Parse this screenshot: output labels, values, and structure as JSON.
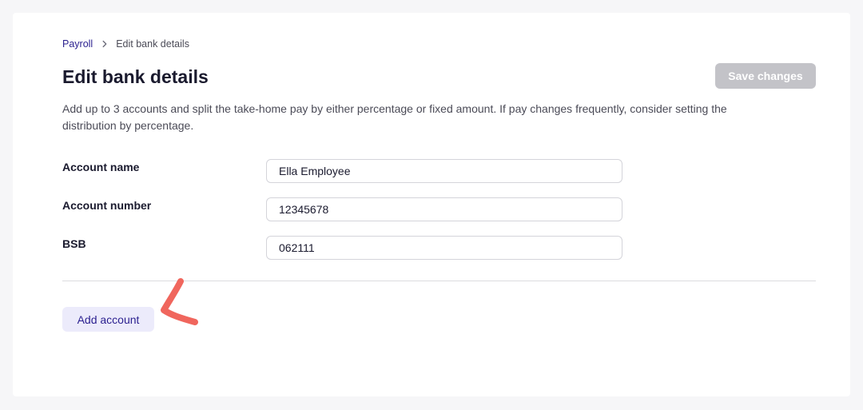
{
  "breadcrumb": {
    "parent": "Payroll",
    "current": "Edit bank details"
  },
  "page": {
    "title": "Edit bank details",
    "save_label": "Save changes",
    "description": "Add up to 3 accounts and split the take-home pay by either percentage or fixed amount. If pay changes frequently, consider setting the distribution by percentage."
  },
  "form": {
    "account_name": {
      "label": "Account name",
      "value": "Ella Employee"
    },
    "account_number": {
      "label": "Account number",
      "value": "12345678"
    },
    "bsb": {
      "label": "BSB",
      "value": "062111"
    }
  },
  "actions": {
    "add_account_label": "Add account"
  },
  "colors": {
    "accent": "#2a1f8f",
    "annotation": "#f0665d",
    "disabled_button": "#c3c3c8"
  },
  "icons": {
    "breadcrumb_separator": "chevron-right-icon",
    "annotation": "arrow-pointer-icon"
  }
}
